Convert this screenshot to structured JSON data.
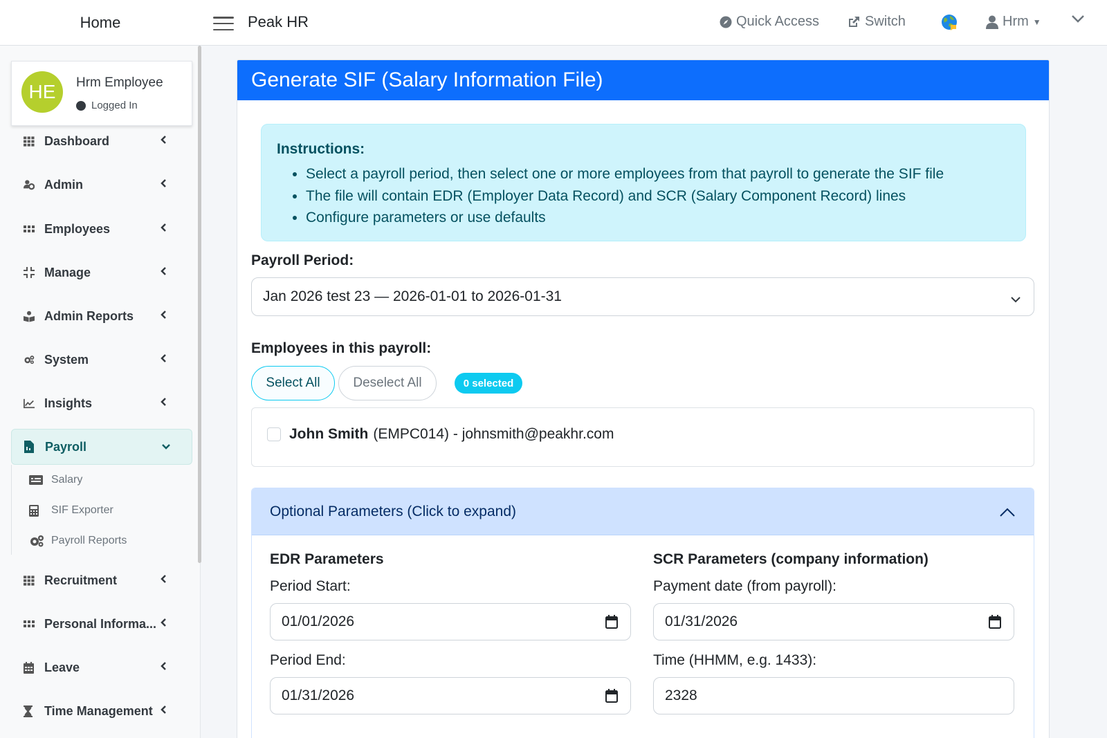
{
  "topbar": {
    "brand": "Home",
    "app_title": "Peak HR",
    "quick_access": "Quick Access",
    "switch": "Switch",
    "user": "Hrm"
  },
  "sidebar": {
    "user_name": "Hrm Employee",
    "user_initials": "HE",
    "user_status": "Logged In",
    "items": [
      {
        "label": "Dashboard",
        "icon": "grid-icon"
      },
      {
        "label": "Admin",
        "icon": "users-cog-icon"
      },
      {
        "label": "Employees",
        "icon": "grid-small-icon"
      },
      {
        "label": "Manage",
        "icon": "compress-icon"
      },
      {
        "label": "Admin Reports",
        "icon": "book-reader-icon"
      },
      {
        "label": "System",
        "icon": "cogs-icon"
      },
      {
        "label": "Insights",
        "icon": "chart-line-icon"
      },
      {
        "label": "Payroll",
        "icon": "file-invoice-icon"
      },
      {
        "label": "Recruitment",
        "icon": "grid-icon"
      },
      {
        "label": "Personal Informa...",
        "icon": "grid-small-icon"
      },
      {
        "label": "Leave",
        "icon": "calendar-icon"
      },
      {
        "label": "Time Management",
        "icon": "hourglass-icon"
      }
    ],
    "payroll_sub": [
      {
        "label": "Salary",
        "icon": "money-check-icon"
      },
      {
        "label": "SIF Exporter",
        "icon": "calculator-icon"
      },
      {
        "label": "Payroll Reports",
        "icon": "cogs-icon"
      }
    ]
  },
  "main": {
    "title": "Generate SIF (Salary Information File)",
    "instructions": {
      "heading": "Instructions:",
      "items": [
        "Select a payroll period, then select one or more employees from that payroll to generate the SIF file",
        "The file will contain EDR (Employer Data Record) and SCR (Salary Component Record) lines",
        "Configure parameters or use defaults"
      ]
    },
    "payroll_period_label": "Payroll Period:",
    "payroll_period_value": "Jan 2026 test 23 — 2026-01-01 to 2026-01-31",
    "employees_label": "Employees in this payroll:",
    "select_all": "Select All",
    "deselect_all": "Deselect All",
    "selected_badge": "0 selected",
    "employee": {
      "name": "John Smith",
      "detail": "(EMPC014) - johnsmith@peakhr.com"
    },
    "optional_params": "Optional Parameters (Click to expand)",
    "edr": {
      "title": "EDR Parameters",
      "period_start_label": "Period Start:",
      "period_start_value": "01/01/2026",
      "period_end_label": "Period End:",
      "period_end_value": "01/31/2026"
    },
    "scr": {
      "title": "SCR Parameters (company information)",
      "payment_date_label": "Payment date (from payroll):",
      "payment_date_value": "01/31/2026",
      "time_label": "Time (HHMM, e.g. 1433):",
      "time_value": "2328"
    }
  },
  "colors": {
    "primary": "#0d6efd",
    "info_bg": "#cff4fc",
    "active_menu_bg": "#e3f4f3",
    "avatar": "#b5cf2d",
    "badge": "#0dcaf0"
  }
}
